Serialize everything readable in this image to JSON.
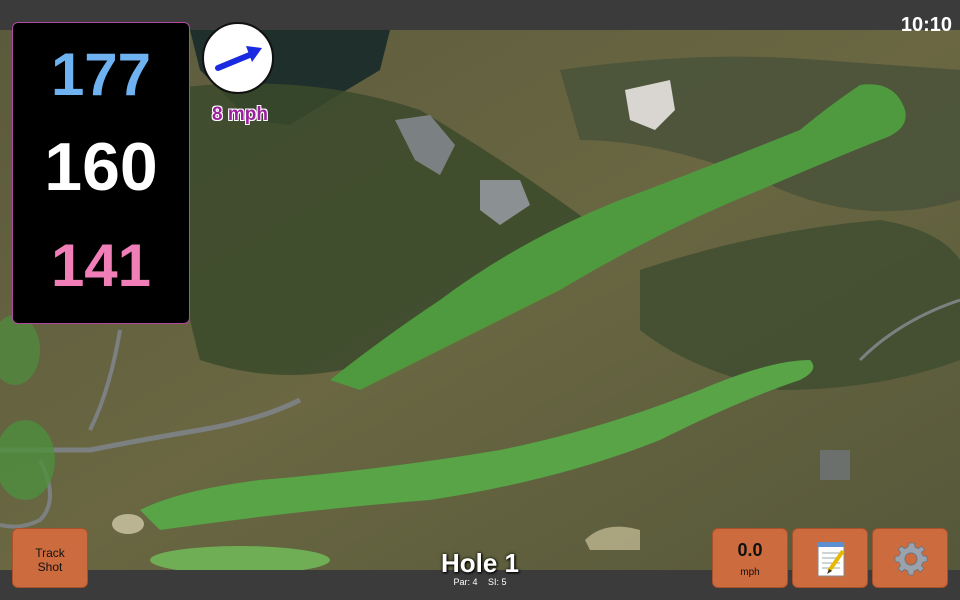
{
  "status": {
    "time": "10:10"
  },
  "distances": {
    "back": {
      "value": "177",
      "color": "#6fb2f2"
    },
    "middle": {
      "value": "160",
      "color": "#ffffff"
    },
    "front": {
      "value": "141",
      "color": "#f07fb8"
    }
  },
  "wind": {
    "speed_label": "8 mph",
    "arrow_color": "#1a2ae0",
    "direction_icon": "arrow-icon"
  },
  "buttons": {
    "track_shot": {
      "line1": "Track",
      "line2": "Shot"
    },
    "speed": {
      "value": "0.0",
      "unit": "mph"
    },
    "notes_icon": "notepad-icon",
    "settings_icon": "gear-icon",
    "button_color": "#cc6b3e"
  },
  "hole": {
    "title": "Hole 1",
    "par_label": "Par: 4",
    "si_label": "SI: 5"
  }
}
